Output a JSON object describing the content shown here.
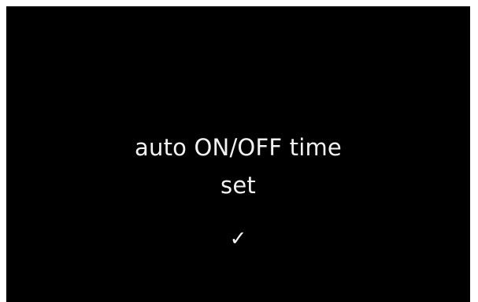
{
  "screen": {
    "message_line1": "auto ON/OFF time",
    "message_line2": "set",
    "confirm_glyph": "✓",
    "confirm_icon": "checkmark-icon",
    "colors": {
      "background": "#000000",
      "text": "#f2f2f2",
      "frame": "#ffffff"
    }
  }
}
